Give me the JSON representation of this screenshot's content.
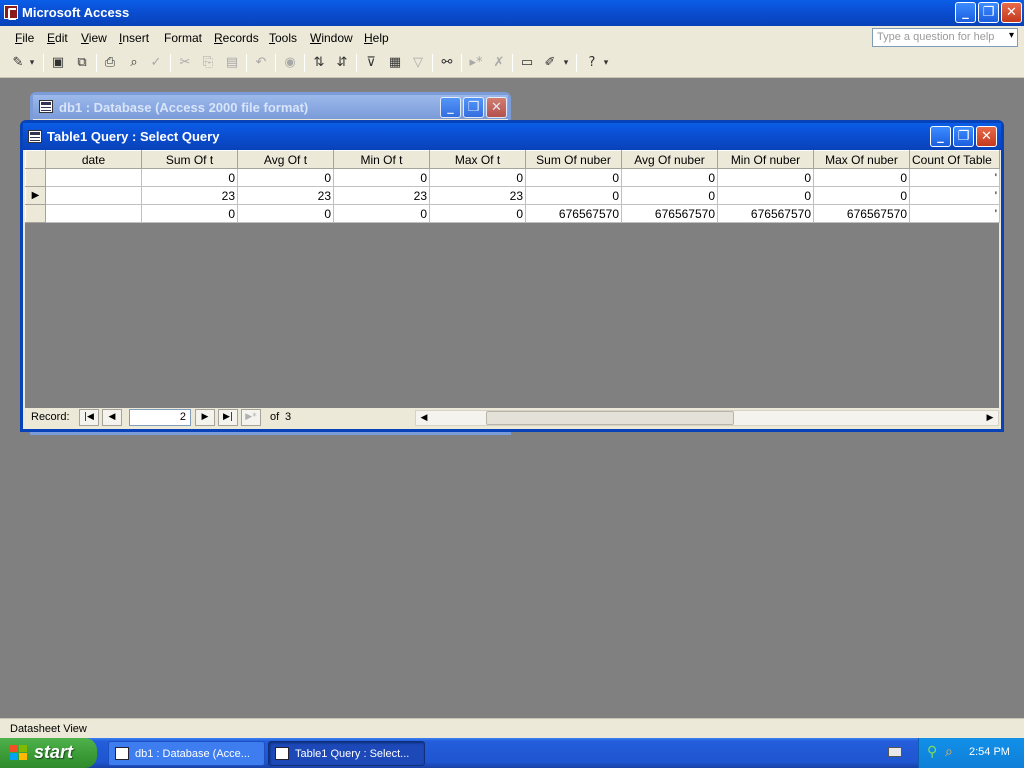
{
  "app": {
    "title": "Microsoft Access",
    "buttons": {
      "minimize": "_",
      "restore": "❐",
      "close": "✕"
    }
  },
  "menu": {
    "items": [
      {
        "ul": "F",
        "rest": "ile"
      },
      {
        "ul": "E",
        "rest": "dit"
      },
      {
        "ul": "V",
        "rest": "iew"
      },
      {
        "ul": "I",
        "rest": "nsert"
      },
      {
        "ul": "",
        "rest": "Format",
        "u_after": "F",
        "full": "Format"
      },
      {
        "ul": "R",
        "rest": "ecords"
      },
      {
        "ul": "T",
        "rest": "ools"
      },
      {
        "ul": "W",
        "rest": "indow"
      },
      {
        "ul": "H",
        "rest": "elp"
      }
    ],
    "help_placeholder": "Type a question for help"
  },
  "toolbar": {
    "icons": [
      "view-icon",
      "dropdown-arrow-icon",
      "save-icon",
      "search-file-icon",
      "print-icon",
      "print-preview-icon",
      "spelling-icon",
      "cut-icon",
      "copy-icon",
      "paste-icon",
      "undo-icon",
      "insert-hyperlink-icon",
      "sort-ascending-icon",
      "sort-descending-icon",
      "filter-by-selection-icon",
      "filter-by-form-icon",
      "apply-filter-icon",
      "find-icon",
      "new-record-icon",
      "delete-record-icon",
      "database-window-icon",
      "new-object-icon",
      "help-icon"
    ]
  },
  "db_window": {
    "title": "db1 : Database (Access 2000 file format)"
  },
  "query_window": {
    "title": "Table1 Query : Select Query"
  },
  "datasheet": {
    "columns": [
      "date",
      "Sum Of t",
      "Avg Of t",
      "Min Of t",
      "Max Of t",
      "Sum Of nuber",
      "Avg Of nuber",
      "Min Of nuber",
      "Max Of nuber",
      "Count Of Table"
    ],
    "rows": [
      [
        "",
        "0",
        "0",
        "0",
        "0",
        "0",
        "0",
        "0",
        "0",
        "'"
      ],
      [
        "",
        "23",
        "23",
        "23",
        "23",
        "0",
        "0",
        "0",
        "0",
        "'"
      ],
      [
        "",
        "0",
        "0",
        "0",
        "0",
        "676567570",
        "676567570",
        "676567570",
        "676567570",
        "'"
      ]
    ],
    "current_row_index": 1,
    "current_row_marker": "▶"
  },
  "navigation": {
    "label": "Record:",
    "current": "2",
    "of_label": "of",
    "total": "3",
    "buttons": {
      "first": "|◀",
      "prev": "◀",
      "next": "▶",
      "last": "▶|",
      "new": "▶*"
    }
  },
  "status": {
    "text": "Datasheet View"
  },
  "taskbar": {
    "start_label": "start",
    "tasks": [
      "db1 : Database (Acce...",
      "Table1 Query : Select..."
    ],
    "clock": "2:54 PM"
  },
  "colors": {
    "titlebar_active": "#0a4fd4",
    "titlebar_inactive": "#7a9bd9",
    "window_face": "#ece9d8",
    "desktop_gray": "#808080",
    "taskbar_blue": "#245edb",
    "start_green": "#3a9a36"
  }
}
